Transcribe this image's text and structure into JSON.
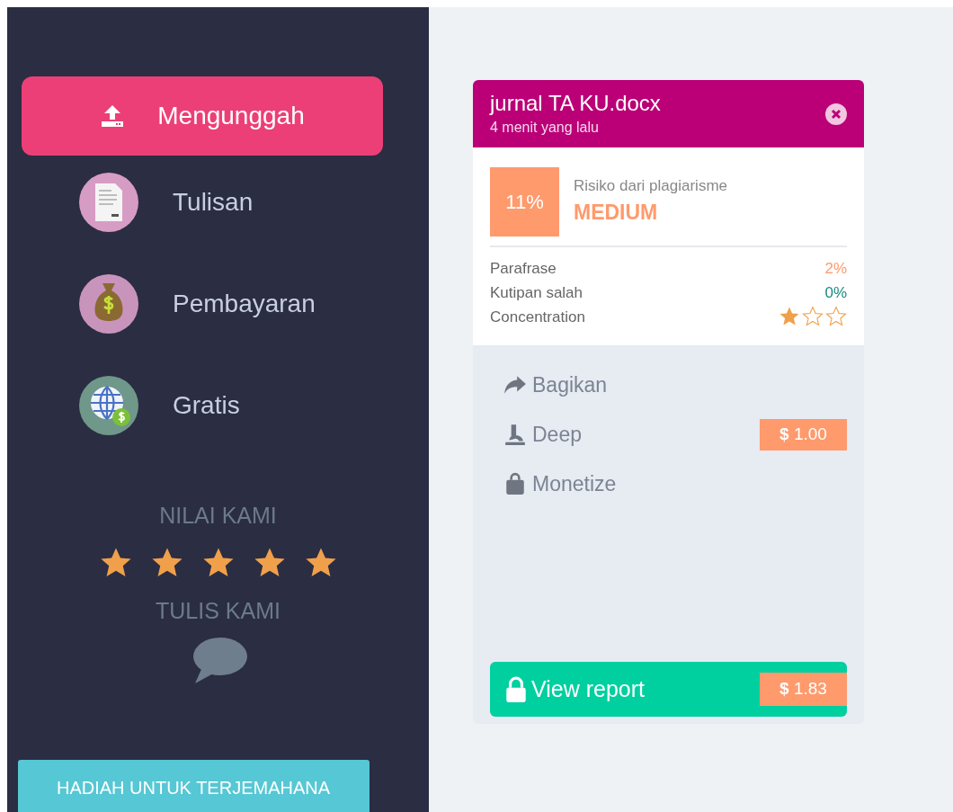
{
  "sidebar": {
    "items": [
      {
        "label": "Mengunggah",
        "kind": "upload",
        "selected": true
      },
      {
        "label": "Tulisan",
        "kind": "document",
        "selected": false
      },
      {
        "label": "Pembayaran",
        "kind": "moneybag",
        "selected": false
      },
      {
        "label": "Gratis",
        "kind": "globe",
        "selected": false
      }
    ],
    "rating": {
      "title": "NILAI KAMI",
      "stars": 5
    },
    "feedback": {
      "title": "TULIS KAMI"
    },
    "promo_button": "HADIAH UNTUK TERJEMAHANA"
  },
  "document": {
    "title": "jurnal TA KU.docx",
    "time": "4 menit yang lalu",
    "score": "11%",
    "risk_label": "Risiko dari plagiarisme",
    "risk_level": "MEDIUM",
    "metrics": [
      {
        "label": "Parafrase",
        "kind": "percent",
        "value": "2%",
        "color": "#ff9a6c"
      },
      {
        "label": "Kutipan salah",
        "kind": "percent",
        "value": "0%",
        "color": "#1a8a80"
      },
      {
        "label": "Concentration",
        "kind": "stars",
        "stars": 1
      }
    ],
    "actions": [
      {
        "label": "Bagikan",
        "kind": "share"
      },
      {
        "label": "Deep",
        "kind": "microscope",
        "price": "**$** 1.00"
      },
      {
        "label": "Monetize",
        "kind": "bag"
      }
    ],
    "report_button": {
      "label": "View report",
      "price": "**$** 1.83"
    }
  }
}
